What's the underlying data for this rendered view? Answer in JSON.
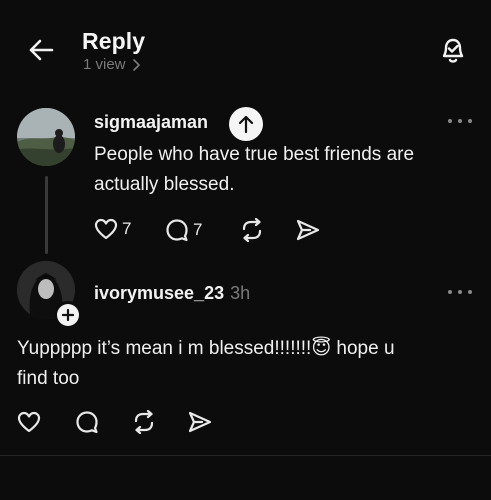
{
  "header": {
    "title": "Reply",
    "views": "1 view"
  },
  "original_post": {
    "username": "sigmaajaman",
    "text_line1": "People who have true best friends are",
    "text_line2": "actually blessed.",
    "like_count": "7",
    "reply_count": "7"
  },
  "reply": {
    "username": "ivorymusee_23",
    "timestamp": "3h",
    "text_line1": "Yuppppp it’s mean i m blessed!!!!!!!😇 hope u",
    "text_line2": "find too"
  },
  "icons": {
    "back": "arrow-left-icon",
    "notify": "bell-check-icon",
    "more": "more-dots-icon",
    "scroll_up": "arrow-up-icon",
    "like": "heart-icon",
    "comment": "comment-icon",
    "repost": "repost-icon",
    "share": "send-icon",
    "follow": "plus-icon"
  },
  "colors": {
    "background": "#0c0c0c",
    "text": "#f2f2f2",
    "muted": "#7a7a7a"
  }
}
